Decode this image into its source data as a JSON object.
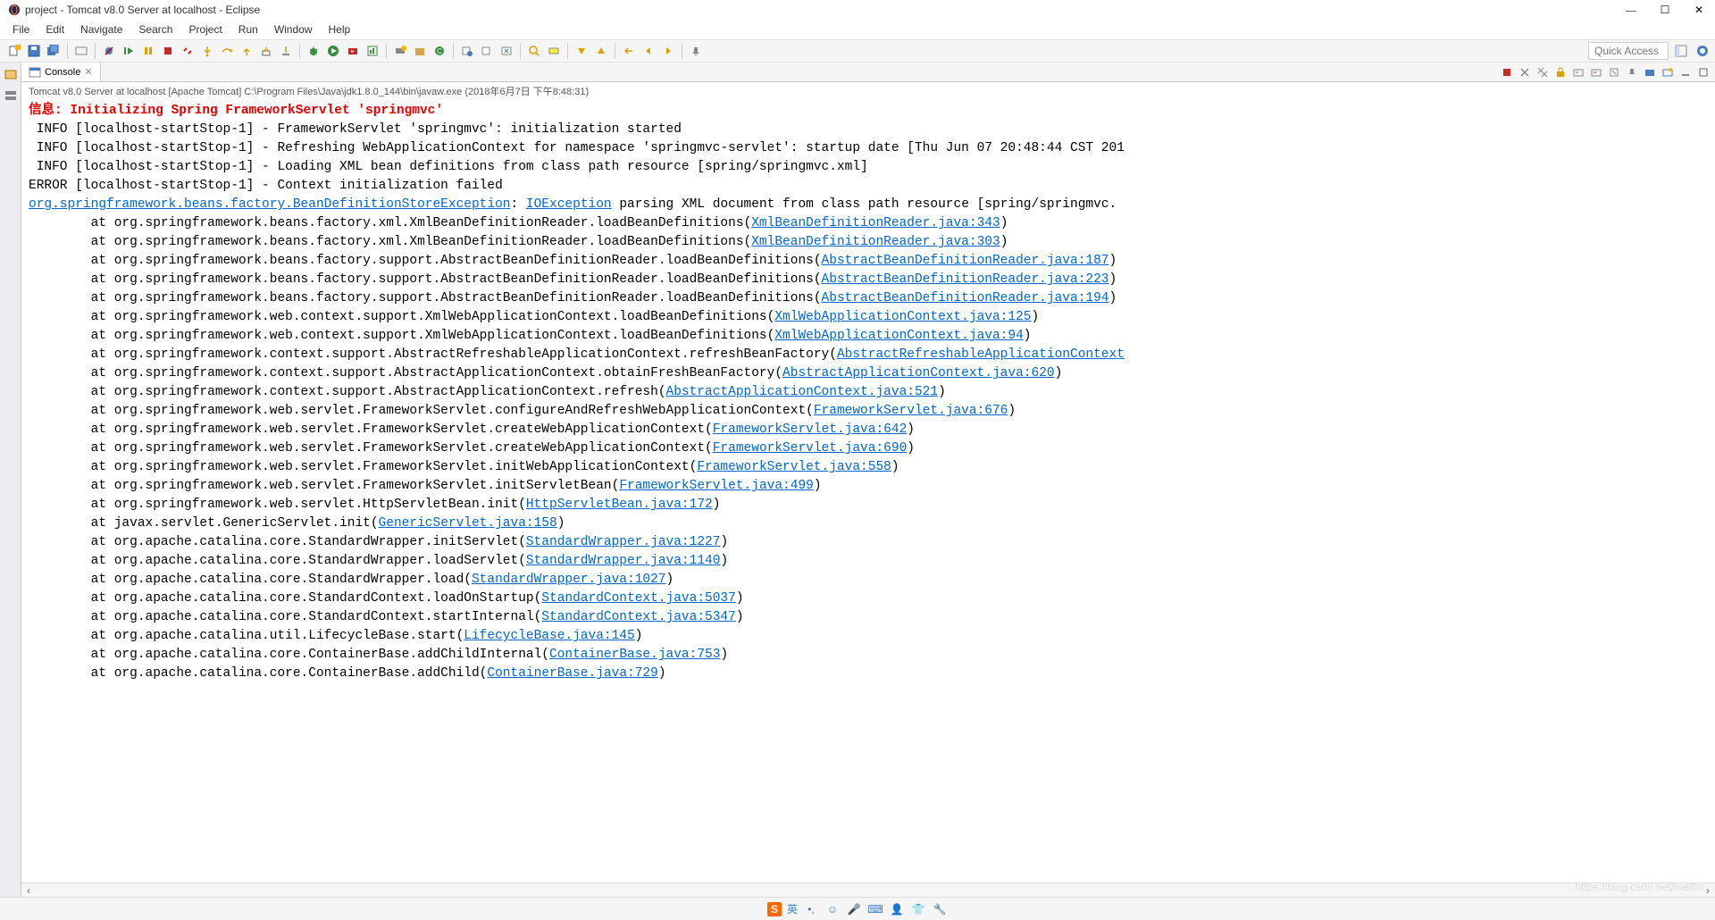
{
  "window": {
    "title": "project - Tomcat v8.0 Server at localhost - Eclipse",
    "minimize": "—",
    "maximize": "☐",
    "close": "✕"
  },
  "menu": {
    "items": [
      "File",
      "Edit",
      "Navigate",
      "Search",
      "Project",
      "Run",
      "Window",
      "Help"
    ]
  },
  "toolbar": {
    "quick_access": "Quick Access"
  },
  "console": {
    "tab_label": "Console",
    "header": "Tomcat v8.0 Server at localhost [Apache Tomcat] C:\\Program Files\\Java\\jdk1.8.0_144\\bin\\javaw.exe (2018年6月7日 下午8:48:31)",
    "lines": [
      {
        "type": "info",
        "text": "信息: Initializing Spring FrameworkServlet 'springmvc'"
      },
      {
        "type": "plain",
        "text": " INFO [localhost-startStop-1] - FrameworkServlet 'springmvc': initialization started"
      },
      {
        "type": "plain",
        "text": " INFO [localhost-startStop-1] - Refreshing WebApplicationContext for namespace 'springmvc-servlet': startup date [Thu Jun 07 20:48:44 CST 201"
      },
      {
        "type": "plain",
        "text": " INFO [localhost-startStop-1] - Loading XML bean definitions from class path resource [spring/springmvc.xml]"
      },
      {
        "type": "plain",
        "text": "ERROR [localhost-startStop-1] - Context initialization failed"
      },
      {
        "type": "exc",
        "prefix": "",
        "link1": "org.springframework.beans.factory.BeanDefinitionStoreException",
        "mid": ": ",
        "link2": "IOException",
        "suffix": " parsing XML document from class path resource [spring/springmvc."
      },
      {
        "type": "stack",
        "prefix": "        at org.springframework.beans.factory.xml.XmlBeanDefinitionReader.loadBeanDefinitions(",
        "link": "XmlBeanDefinitionReader.java:343",
        "suffix": ")"
      },
      {
        "type": "stack",
        "prefix": "        at org.springframework.beans.factory.xml.XmlBeanDefinitionReader.loadBeanDefinitions(",
        "link": "XmlBeanDefinitionReader.java:303",
        "suffix": ")"
      },
      {
        "type": "stack",
        "prefix": "        at org.springframework.beans.factory.support.AbstractBeanDefinitionReader.loadBeanDefinitions(",
        "link": "AbstractBeanDefinitionReader.java:187",
        "suffix": ")"
      },
      {
        "type": "stack",
        "prefix": "        at org.springframework.beans.factory.support.AbstractBeanDefinitionReader.loadBeanDefinitions(",
        "link": "AbstractBeanDefinitionReader.java:223",
        "suffix": ")"
      },
      {
        "type": "stack",
        "prefix": "        at org.springframework.beans.factory.support.AbstractBeanDefinitionReader.loadBeanDefinitions(",
        "link": "AbstractBeanDefinitionReader.java:194",
        "suffix": ")"
      },
      {
        "type": "stack",
        "prefix": "        at org.springframework.web.context.support.XmlWebApplicationContext.loadBeanDefinitions(",
        "link": "XmlWebApplicationContext.java:125",
        "suffix": ")"
      },
      {
        "type": "stack",
        "prefix": "        at org.springframework.web.context.support.XmlWebApplicationContext.loadBeanDefinitions(",
        "link": "XmlWebApplicationContext.java:94",
        "suffix": ")"
      },
      {
        "type": "stack",
        "prefix": "        at org.springframework.context.support.AbstractRefreshableApplicationContext.refreshBeanFactory(",
        "link": "AbstractRefreshableApplicationContext",
        "suffix": ""
      },
      {
        "type": "stack",
        "prefix": "        at org.springframework.context.support.AbstractApplicationContext.obtainFreshBeanFactory(",
        "link": "AbstractApplicationContext.java:620",
        "suffix": ")"
      },
      {
        "type": "stack",
        "prefix": "        at org.springframework.context.support.AbstractApplicationContext.refresh(",
        "link": "AbstractApplicationContext.java:521",
        "suffix": ")"
      },
      {
        "type": "stack",
        "prefix": "        at org.springframework.web.servlet.FrameworkServlet.configureAndRefreshWebApplicationContext(",
        "link": "FrameworkServlet.java:676",
        "suffix": ")"
      },
      {
        "type": "stack",
        "prefix": "        at org.springframework.web.servlet.FrameworkServlet.createWebApplicationContext(",
        "link": "FrameworkServlet.java:642",
        "suffix": ")"
      },
      {
        "type": "stack",
        "prefix": "        at org.springframework.web.servlet.FrameworkServlet.createWebApplicationContext(",
        "link": "FrameworkServlet.java:690",
        "suffix": ")"
      },
      {
        "type": "stack",
        "prefix": "        at org.springframework.web.servlet.FrameworkServlet.initWebApplicationContext(",
        "link": "FrameworkServlet.java:558",
        "suffix": ")"
      },
      {
        "type": "stack",
        "prefix": "        at org.springframework.web.servlet.FrameworkServlet.initServletBean(",
        "link": "FrameworkServlet.java:499",
        "suffix": ")"
      },
      {
        "type": "stack",
        "prefix": "        at org.springframework.web.servlet.HttpServletBean.init(",
        "link": "HttpServletBean.java:172",
        "suffix": ")"
      },
      {
        "type": "stack",
        "prefix": "        at javax.servlet.GenericServlet.init(",
        "link": "GenericServlet.java:158",
        "suffix": ")"
      },
      {
        "type": "stack",
        "prefix": "        at org.apache.catalina.core.StandardWrapper.initServlet(",
        "link": "StandardWrapper.java:1227",
        "suffix": ")"
      },
      {
        "type": "stack",
        "prefix": "        at org.apache.catalina.core.StandardWrapper.loadServlet(",
        "link": "StandardWrapper.java:1140",
        "suffix": ")"
      },
      {
        "type": "stack",
        "prefix": "        at org.apache.catalina.core.StandardWrapper.load(",
        "link": "StandardWrapper.java:1027",
        "suffix": ")"
      },
      {
        "type": "stack",
        "prefix": "        at org.apache.catalina.core.StandardContext.loadOnStartup(",
        "link": "StandardContext.java:5037",
        "suffix": ")"
      },
      {
        "type": "stack",
        "prefix": "        at org.apache.catalina.core.StandardContext.startInternal(",
        "link": "StandardContext.java:5347",
        "suffix": ")"
      },
      {
        "type": "stack",
        "prefix": "        at org.apache.catalina.util.LifecycleBase.start(",
        "link": "LifecycleBase.java:145",
        "suffix": ")"
      },
      {
        "type": "stack",
        "prefix": "        at org.apache.catalina.core.ContainerBase.addChildInternal(",
        "link": "ContainerBase.java:753",
        "suffix": ")"
      },
      {
        "type": "stack",
        "prefix": "        at org.apache.catalina.core.ContainerBase.addChild(",
        "link": "ContainerBase.java:729",
        "suffix": ")"
      }
    ]
  },
  "status": {
    "ime_label": "S",
    "ime_text": "英"
  },
  "watermark": "https://blog.csdn.net/meillin"
}
